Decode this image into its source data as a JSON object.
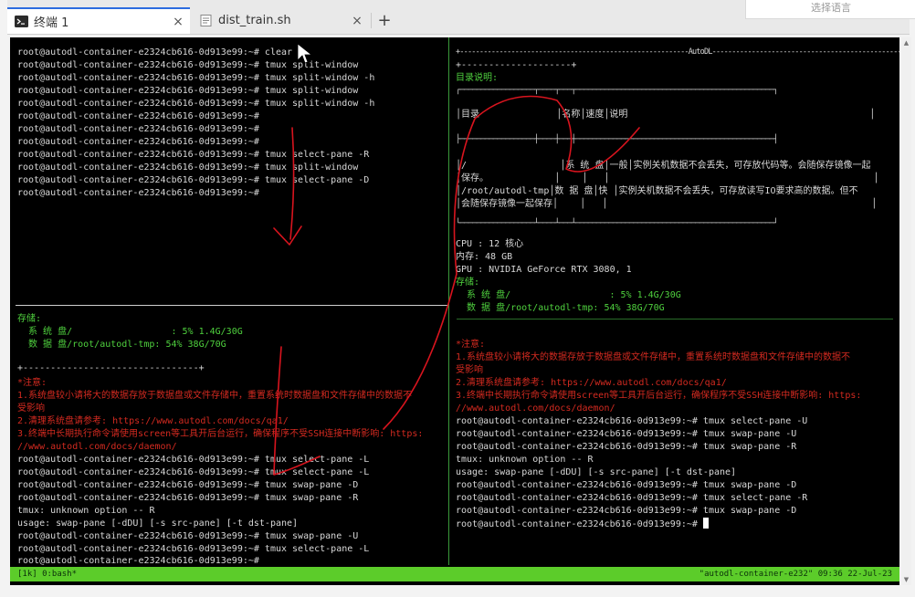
{
  "tabs": [
    {
      "label": "终端 1",
      "close": "×"
    },
    {
      "label": "dist_train.sh",
      "close": "×"
    }
  ],
  "new_tab": "+",
  "language_selector": "选择语言",
  "left_pane": {
    "top_lines": [
      "root@autodl-container-e2324cb616-0d913e99:~# clear",
      "root@autodl-container-e2324cb616-0d913e99:~# tmux split-window",
      "root@autodl-container-e2324cb616-0d913e99:~# tmux split-window -h",
      "root@autodl-container-e2324cb616-0d913e99:~# tmux split-window",
      "root@autodl-container-e2324cb616-0d913e99:~# tmux split-window -h",
      "root@autodl-container-e2324cb616-0d913e99:~#",
      "root@autodl-container-e2324cb616-0d913e99:~#",
      "root@autodl-container-e2324cb616-0d913e99:~#",
      "root@autodl-container-e2324cb616-0d913e99:~# tmux select-pane -R",
      "root@autodl-container-e2324cb616-0d913e99:~# tmux split-window",
      "root@autodl-container-e2324cb616-0d913e99:~# tmux select-pane -D",
      "root@autodl-container-e2324cb616-0d913e99:~#"
    ],
    "storage_title": "存储:",
    "storage_lines": [
      "  系 统 盘/                  : 5% 1.4G/30G",
      "  数 据 盘/root/autodl-tmp: 54% 38G/70G"
    ],
    "rule": "+--------------------------------+",
    "notice_title": "*注意:",
    "notice_lines": [
      "1.系统盘较小请将大的数据存放于数据盘或文件存储中，重置系统时数据盘和文件存储中的数据不",
      "受影响",
      "2.清理系统盘请参考: https://www.autodl.com/docs/qa1/",
      "3.终端中长期执行命令请使用screen等工具开后台运行，确保程序不受SSH连接中断影响: https:",
      "//www.autodl.com/docs/daemon/"
    ],
    "bottom_lines": [
      "root@autodl-container-e2324cb616-0d913e99:~# tmux select-pane -L",
      "root@autodl-container-e2324cb616-0d913e99:~# tmux select-pane -L",
      "root@autodl-container-e2324cb616-0d913e99:~# tmux swap-pane -D",
      "root@autodl-container-e2324cb616-0d913e99:~# tmux swap-pane -R",
      "tmux: unknown option -- R",
      "usage: swap-pane [-dDU] [-s src-pane] [-t dst-pane]",
      "root@autodl-container-e2324cb616-0d913e99:~# tmux swap-pane -U",
      "root@autodl-container-e2324cb616-0d913e99:~# tmux select-pane -L",
      "root@autodl-container-e2324cb616-0d913e99:~#"
    ]
  },
  "right_pane": {
    "banner": "+----------------------------------------------------------AutoDL-------------------------------------------------------------+",
    "rule_short": "+--------------------+",
    "dir_title": "目录说明:",
    "table_lines": [
      "┌──────────────────┬────┬───┬────────────────────────────────────────────────┐",
      "│目录              │名称│速度│说明                                            │",
      "├──────────────────┼────┼───┼────────────────────────────────────────────────┤",
      "│/                 │系 统 盘│一般│实例关机数据不会丢失，可存放代码等。会随保存镜像一起",
      "│保存。            │    │   │                                                │",
      "│/root/autodl-tmp│数 据 盘│快 │实例关机数据不会丢失，可存放读写IO要求高的数据。但不",
      "│会随保存镜像一起保存│    │   │                                                │",
      "└──────────────────┴────┴───┴────────────────────────────────────────────────┘"
    ],
    "cpu": "CPU : 12 核心",
    "mem": "内存: 48 GB",
    "gpu": "GPU : NVIDIA GeForce RTX 3080, 1",
    "storage_title": "存储:",
    "storage_lines": [
      "  系 统 盘/                  : 5% 1.4G/30G",
      "  数 据 盘/root/autodl-tmp: 54% 38G/70G"
    ],
    "rule_long": "+------------------------------------------------------------------------+",
    "notice_title": "*注意:",
    "notice_lines": [
      "1.系统盘较小请将大的数据存放于数据盘或文件存储中，重置系统时数据盘和文件存储中的数据不",
      "受影响",
      "2.清理系统盘请参考: https://www.autodl.com/docs/qa1/",
      "3.终端中长期执行命令请使用screen等工具开后台运行，确保程序不受SSH连接中断影响: https:",
      "//www.autodl.com/docs/daemon/"
    ],
    "bottom_lines": [
      "root@autodl-container-e2324cb616-0d913e99:~# tmux select-pane -U",
      "root@autodl-container-e2324cb616-0d913e99:~# tmux swap-pane -U",
      "root@autodl-container-e2324cb616-0d913e99:~# tmux swap-pane -R",
      "tmux: unknown option -- R",
      "usage: swap-pane [-dDU] [-s src-pane] [-t dst-pane]",
      "root@autodl-container-e2324cb616-0d913e99:~# tmux swap-pane -D",
      "root@autodl-container-e2324cb616-0d913e99:~# tmux select-pane -R",
      "root@autodl-container-e2324cb616-0d913e99:~# tmux swap-pane -D",
      "root@autodl-container-e2324cb616-0d913e99:~#"
    ]
  },
  "status_bar": {
    "left": "[1k] 0:bash*",
    "right": "\"autodl-container-e232\" 09:36 22-Jul-23"
  },
  "scrollbar": {
    "up": "▲",
    "down": "▼"
  },
  "colors": {
    "terminal_bg": "#000000",
    "status_green": "#5ccc2a",
    "annotation_red": "#d8141e"
  }
}
